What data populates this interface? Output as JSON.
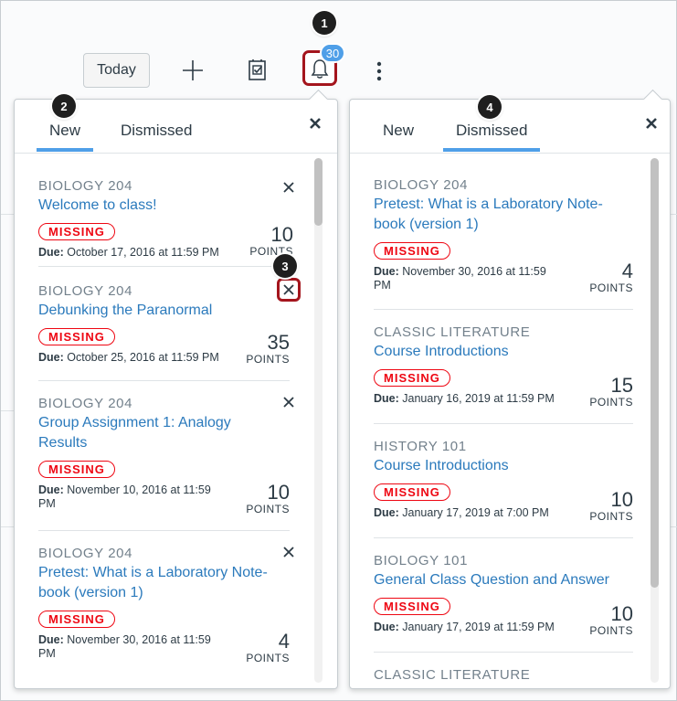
{
  "toolbar": {
    "today_label": "Today",
    "plus_icon": "plus-icon",
    "planner_icon": "checklist-icon",
    "bell_icon": "bell-icon",
    "bell_badge": "30",
    "more_icon": "kebab-icon"
  },
  "callouts": [
    "1",
    "2",
    "3",
    "4"
  ],
  "left_panel": {
    "tabs": [
      {
        "label": "New",
        "active": true
      },
      {
        "label": "Dismissed",
        "active": false
      }
    ],
    "close_icon": "close-icon",
    "items": [
      {
        "course": "BIOLOGY 204",
        "title": "Welcome to class!",
        "badge": "MISSING",
        "due_label": "Due:",
        "due_date": "October 17, 2016 at 11:59 PM",
        "points": "10",
        "points_label": "POINTS"
      },
      {
        "course": "BIOLOGY 204",
        "title": "Debunking the Paranormal",
        "badge": "MISSING",
        "due_label": "Due:",
        "due_date": "October 25, 2016 at 11:59 PM",
        "points": "35",
        "points_label": "POINTS"
      },
      {
        "course": "BIOLOGY 204",
        "title": "Group Assignment 1: Analogy Results",
        "badge": "MISSING",
        "due_label": "Due:",
        "due_date": "November 10, 2016 at 11:59 PM",
        "points": "10",
        "points_label": "POINTS"
      },
      {
        "course": "BIOLOGY 204",
        "title": "Pretest: What is a Laboratory Note-book (version 1)",
        "badge": "MISSING",
        "due_label": "Due:",
        "due_date": "November 30, 2016 at 11:59 PM",
        "points": "4",
        "points_label": "POINTS"
      }
    ]
  },
  "right_panel": {
    "tabs": [
      {
        "label": "New",
        "active": false
      },
      {
        "label": "Dismissed",
        "active": true
      }
    ],
    "close_icon": "close-icon",
    "items": [
      {
        "course": "BIOLOGY 204",
        "title": "Pretest: What is a Laboratory Note-book (version 1)",
        "badge": "MISSING",
        "due_label": "Due:",
        "due_date": "November 30, 2016 at 11:59 PM",
        "points": "4",
        "points_label": "POINTS"
      },
      {
        "course": "CLASSIC LITERATURE",
        "title": "Course Introductions",
        "badge": "MISSING",
        "due_label": "Due:",
        "due_date": "January 16, 2019 at 11:59 PM",
        "points": "15",
        "points_label": "POINTS"
      },
      {
        "course": "HISTORY 101",
        "title": "Course Introductions",
        "badge": "MISSING",
        "due_label": "Due:",
        "due_date": "January 17, 2019 at 7:00 PM",
        "points": "10",
        "points_label": "POINTS"
      },
      {
        "course": "BIOLOGY 101",
        "title": "General Class Question and Answer",
        "badge": "MISSING",
        "due_label": "Due:",
        "due_date": "January 17, 2019 at 11:59 PM",
        "points": "10",
        "points_label": "POINTS"
      },
      {
        "course": "CLASSIC LITERATURE",
        "title": "",
        "badge": "",
        "due_label": "",
        "due_date": "",
        "points": "",
        "points_label": ""
      }
    ]
  },
  "colors": {
    "accent": "#4f9fe8",
    "link": "#2b7abc",
    "missing": "#ee0612",
    "highlight": "#a4151d"
  }
}
